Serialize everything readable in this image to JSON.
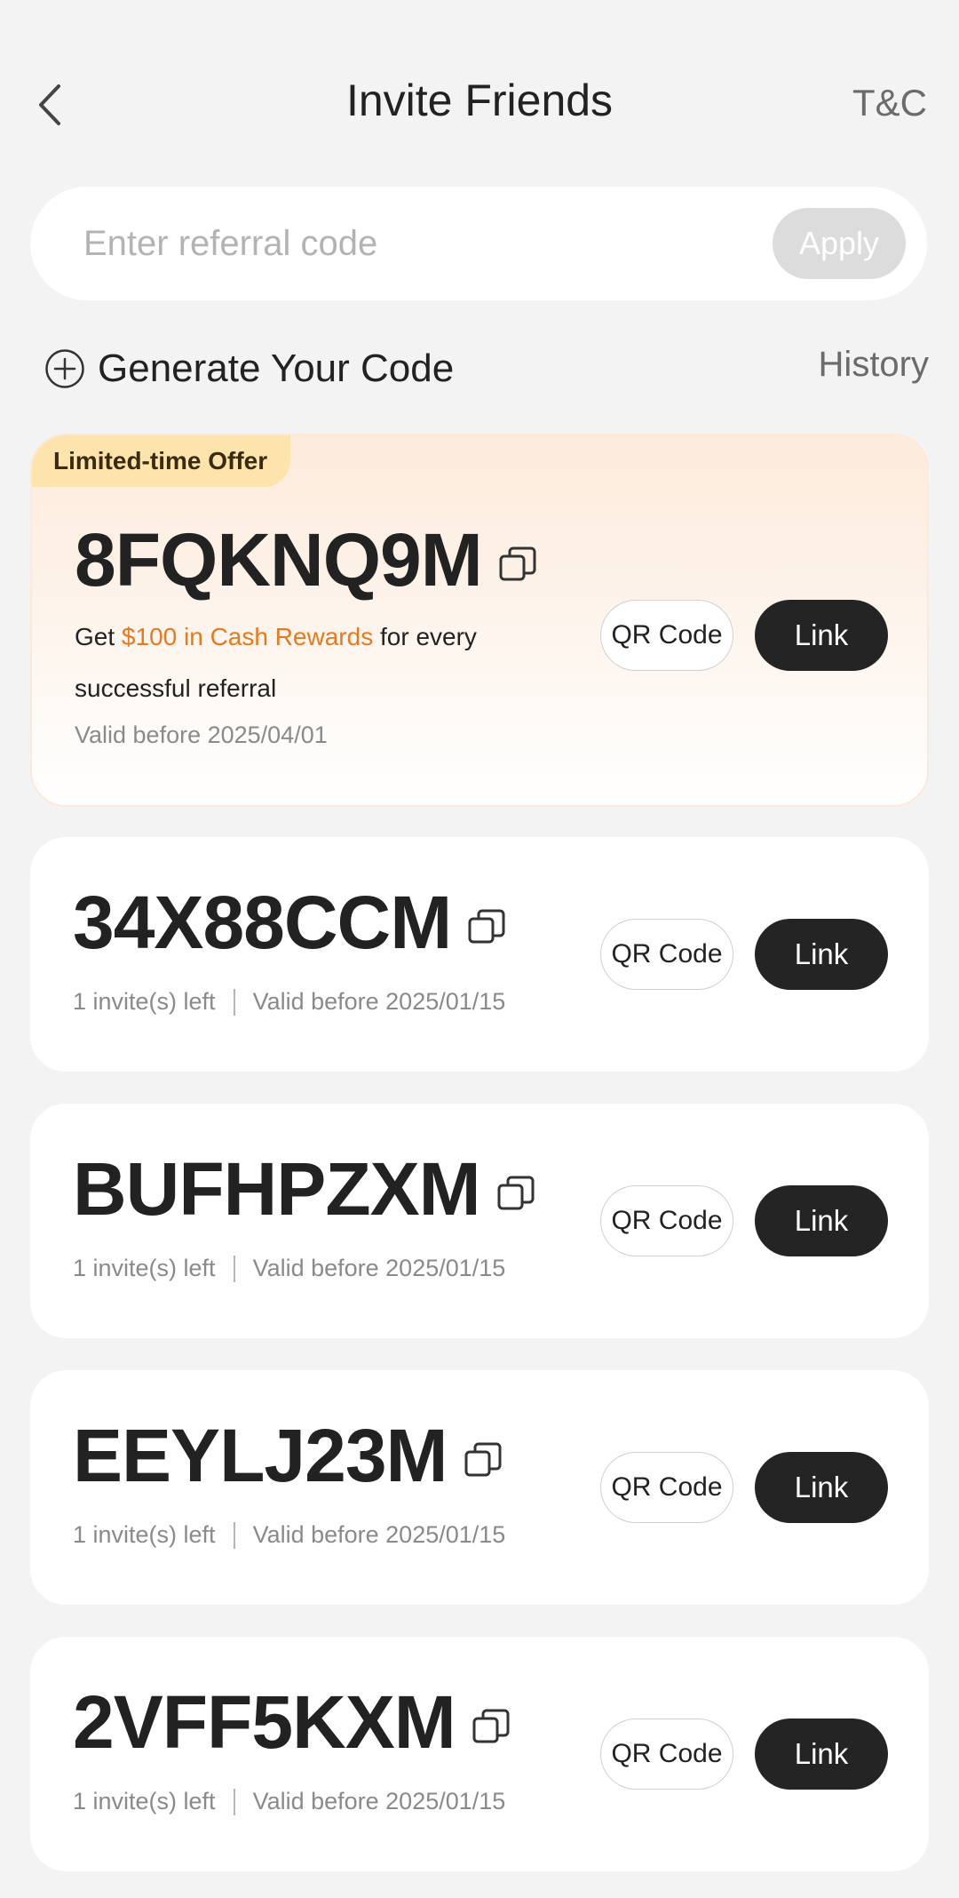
{
  "header": {
    "title": "Invite Friends",
    "tnc_label": "T&C",
    "back_icon": "chevron-left-icon"
  },
  "referral": {
    "placeholder": "Enter referral code",
    "value": "",
    "apply_label": "Apply"
  },
  "generate": {
    "label": "Generate Your Code",
    "icon": "plus-circle-icon",
    "history_label": "History"
  },
  "offer_card": {
    "badge": "Limited-time Offer",
    "code": "8FQKNQ9M",
    "desc_prefix": "Get ",
    "desc_highlight": "$100 in Cash Rewards",
    "desc_suffix": " for every successful referral",
    "valid": "Valid before 2025/04/01",
    "qr_label": "QR Code",
    "link_label": "Link",
    "highlight_color": "#e8791c",
    "badge_color": "#fde3ac"
  },
  "codes": [
    {
      "code": "34X88CCM",
      "invites": "1 invite(s) left",
      "valid": "Valid before 2025/01/15",
      "qr_label": "QR Code",
      "link_label": "Link"
    },
    {
      "code": "BUFHPZXM",
      "invites": "1 invite(s) left",
      "valid": "Valid before 2025/01/15",
      "qr_label": "QR Code",
      "link_label": "Link"
    },
    {
      "code": "EEYLJ23M",
      "invites": "1 invite(s) left",
      "valid": "Valid before 2025/01/15",
      "qr_label": "QR Code",
      "link_label": "Link"
    },
    {
      "code": "2VFF5KXM",
      "invites": "1 invite(s) left",
      "valid": "Valid before 2025/01/15",
      "qr_label": "QR Code",
      "link_label": "Link"
    }
  ],
  "icons": {
    "copy": "copy-icon"
  },
  "colors": {
    "link_button": "#242424",
    "apply_button_disabled": "#dcdcdc",
    "background": "#f3f3f3"
  }
}
